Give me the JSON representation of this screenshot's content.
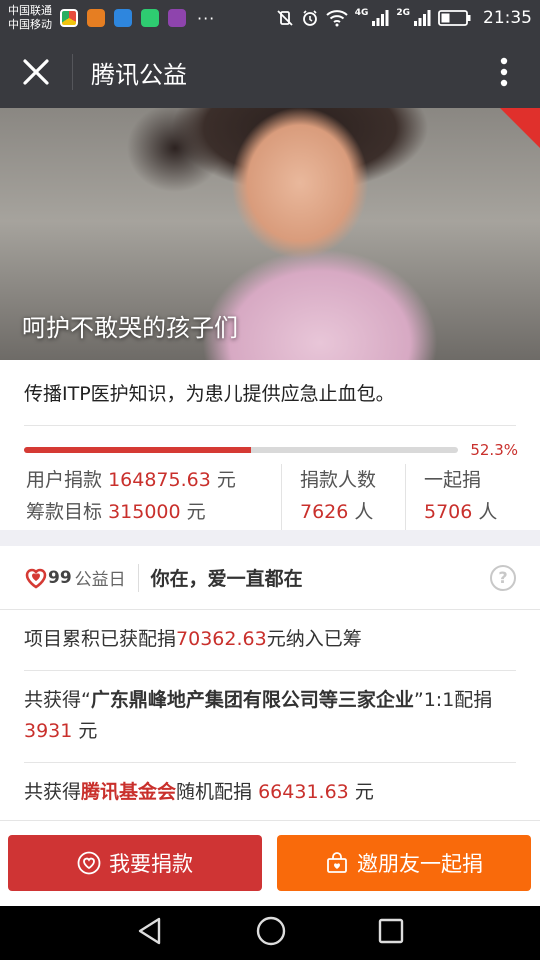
{
  "status_bar": {
    "carrier_1": "中国联通",
    "carrier_2": "中国移动",
    "net_4g": "4G",
    "net_2g": "2G",
    "time": "21:35",
    "more_dots": "···"
  },
  "appbar": {
    "title": "腾讯公益"
  },
  "hero": {
    "title": "呵护不敢哭的孩子们"
  },
  "project": {
    "description": "传播ITP医护知识，为患儿提供应急止血包。",
    "progress_percent": 52.3,
    "progress_label": "52.3%",
    "raised_label": "用户捐款",
    "raised_value": "164875.63",
    "raised_unit": "元",
    "target_label": "筹款目标",
    "target_value": "315000",
    "target_unit": "元",
    "donors_label": "捐款人数",
    "donors_value": "7626",
    "donors_unit": "人",
    "together_label": "一起捐",
    "together_value": "5706",
    "together_unit": "人"
  },
  "event": {
    "logo_num": "99",
    "logo_text": "公益日",
    "title": "你在，爱一直都在",
    "help_symbol": "?"
  },
  "matches": [
    {
      "prefix": "项目累积已获配捐",
      "amount": "70362.63",
      "suffix": "元纳入已筹"
    },
    {
      "prefix": "共获得“",
      "company": "广东鼎峰地产集团有限公司等三家企业",
      "mid": "”1:1配捐",
      "amount": "3931",
      "suffix": "元"
    },
    {
      "prefix": "共获得",
      "company": "腾讯基金会",
      "mid": "随机配捐",
      "amount": "66431.63",
      "suffix": "元"
    }
  ],
  "actions": {
    "donate_label": "我要捐款",
    "invite_label": "邀朋友一起捐"
  },
  "colors": {
    "accent_red": "#c9302c",
    "donate_button": "#cf3434",
    "invite_button": "#f96a0b",
    "header_bg": "#393a3f"
  }
}
